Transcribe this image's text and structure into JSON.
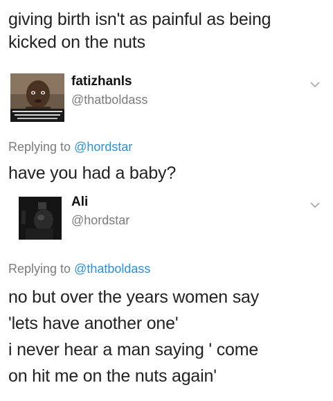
{
  "tweet1": {
    "lines": [
      "giving birth isn't as painful as being",
      "kicked on the nuts"
    ]
  },
  "reply1": {
    "display_name": "fatizhanls",
    "handle": "@thatboldass",
    "avatar_icon": "person-photo-icon",
    "replying_prefix": "Replying to",
    "replying_to": "@hordstar",
    "text": "have you had a baby?"
  },
  "reply2": {
    "display_name": "Ali",
    "handle": "@hordstar",
    "avatar_icon": "dark-photo-icon",
    "replying_prefix": "Replying to",
    "replying_to": "@thatboldass",
    "lines": [
      "no but over the years women say",
      "'lets have another one'",
      "i never hear a man saying ' come",
      "on hit me on the nuts again'"
    ]
  },
  "colors": {
    "text": "#222222",
    "muted": "#7b7b7b",
    "link": "#2e8fd8"
  }
}
